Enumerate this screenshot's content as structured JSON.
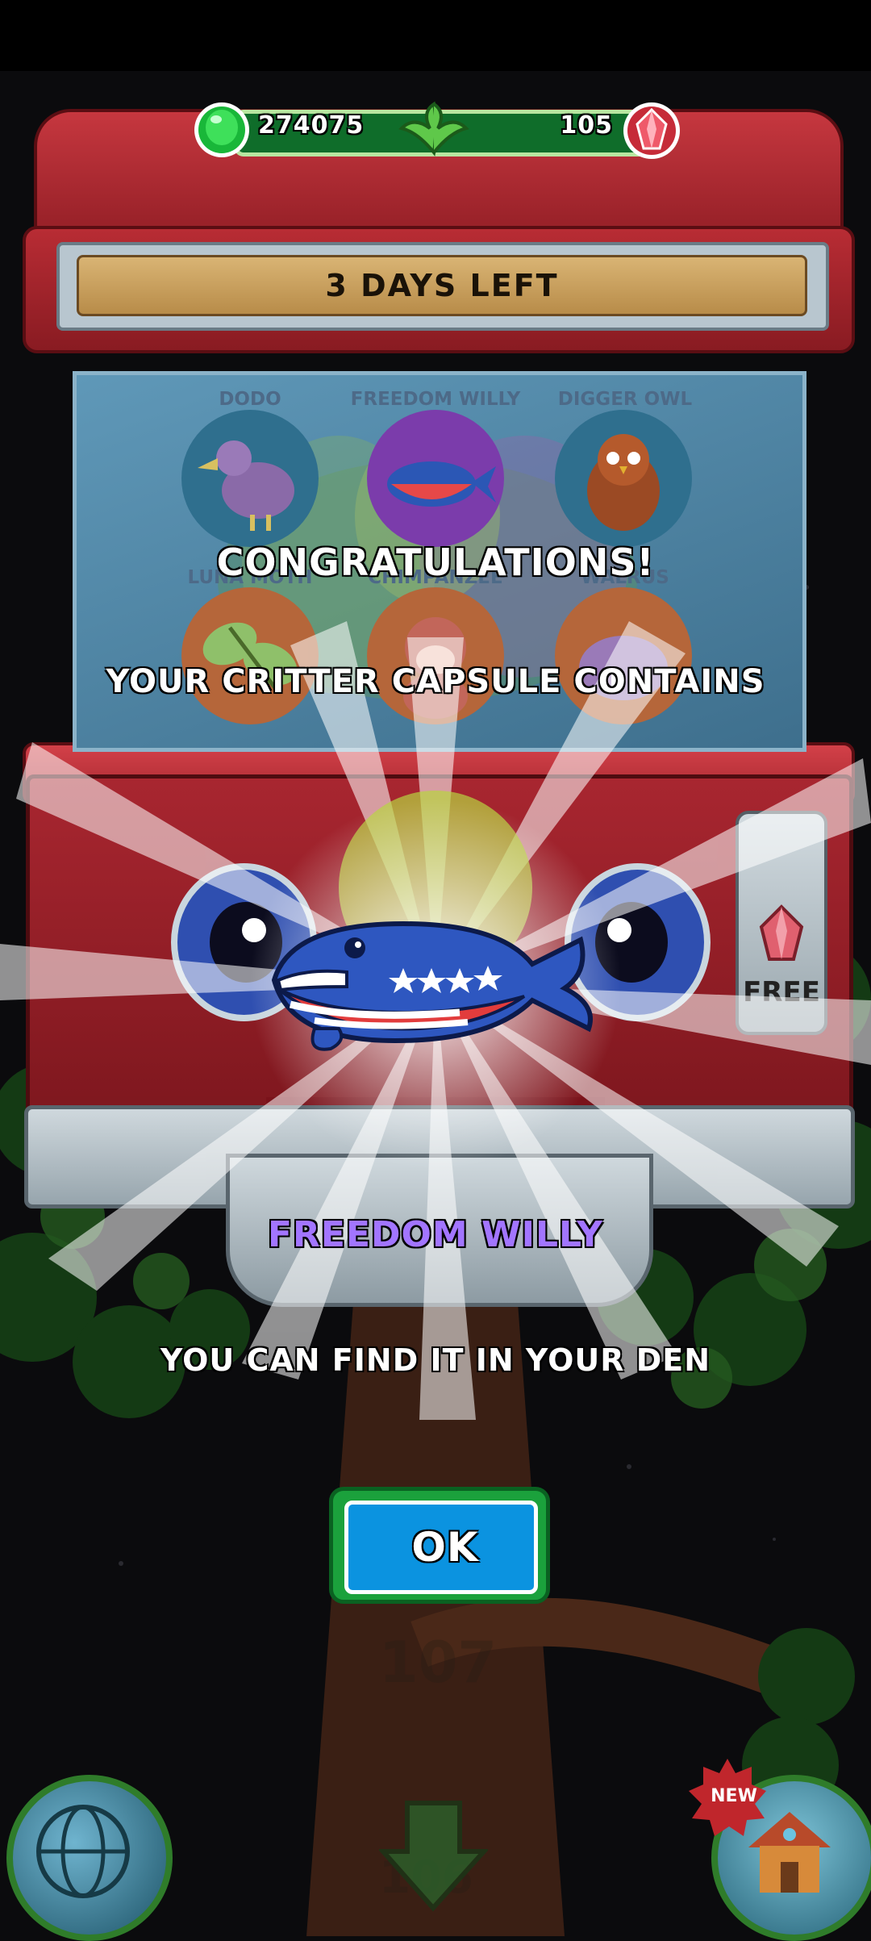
{
  "currency": {
    "gel_count": "274075",
    "gem_count": "105"
  },
  "banner": {
    "time_left": "3 DAYS LEFT"
  },
  "critters": [
    {
      "name": "DODO",
      "bg": "#2f6f8e"
    },
    {
      "name": "FREEDOM WILLY",
      "bg": "#7b3cab"
    },
    {
      "name": "DIGGER OWL",
      "bg": "#2f6f8e"
    },
    {
      "name": "LUNA MOTH",
      "bg": "#b5663a"
    },
    {
      "name": "CHIMPANZEE",
      "bg": "#b5663a"
    },
    {
      "name": "WALRUS",
      "bg": "#b5663a"
    }
  ],
  "reward": {
    "title": "CONGRATULATIONS!",
    "subtitle": "YOUR CRITTER CAPSULE CONTAINS",
    "name": "FREEDOM WILLY",
    "message": "YOU CAN FIND IT IN YOUR DEN",
    "button_label": "OK"
  },
  "machine": {
    "free_label": "FREE"
  },
  "background": {
    "ghost_numbers": [
      "107",
      "106"
    ],
    "new_badge": "NEW"
  },
  "colors": {
    "accent_green": "#1ba13c",
    "button_blue": "#0b93e0",
    "machine_red": "#b82c34",
    "reward_purple": "#a275ff"
  }
}
